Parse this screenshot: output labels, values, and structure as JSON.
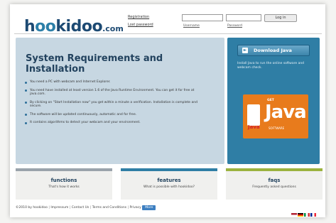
{
  "brand": {
    "logo_h": "h",
    "logo_o1": "o",
    "logo_o2": "o",
    "logo_rest": "kidoo",
    "logo_com": ".com"
  },
  "header": {
    "links": [
      "Registration",
      "Lost password"
    ],
    "login_labels": [
      "Username",
      "Password"
    ],
    "login_button": "Log in"
  },
  "main": {
    "title": "System Requirements and Installation",
    "items": [
      "You need a PC with webcam and Internet Explorer.",
      "You need have installed at least version 1.6 of the Java Runtime Environment. You can get it for free at java.com.",
      "By clicking on \"Start Installation now\" you get within a minute a verification. Installation is complete and secure.",
      "The software will be updated continuously, automatic and for free.",
      "It contains algorithms to detect your webcam and your environment."
    ]
  },
  "java": {
    "download_label": "Download Java",
    "note": "Install Java to run the online software and webcam check.",
    "logo_get": "GET",
    "logo_word": "Java",
    "logo_tag": "SOFTWARE",
    "logo_cup": "Java"
  },
  "cards": [
    {
      "title": "functions",
      "sub": "That's how it works",
      "color": "#9aa3ab"
    },
    {
      "title": "features",
      "sub": "What is possible with hookidoo?",
      "color": "#2f7ea5"
    },
    {
      "title": "faqs",
      "sub": "Frequently asked questions",
      "color": "#9bb23e"
    }
  ],
  "footer": {
    "copyright": "©2010 by hookidoo",
    "links": [
      "Impressum",
      "Contact Us",
      "Terms and Conditions",
      "Privacy"
    ],
    "button": "More"
  },
  "flags": [
    "#b22234",
    "#f5b800",
    "#dd0000",
    "#009246"
  ]
}
